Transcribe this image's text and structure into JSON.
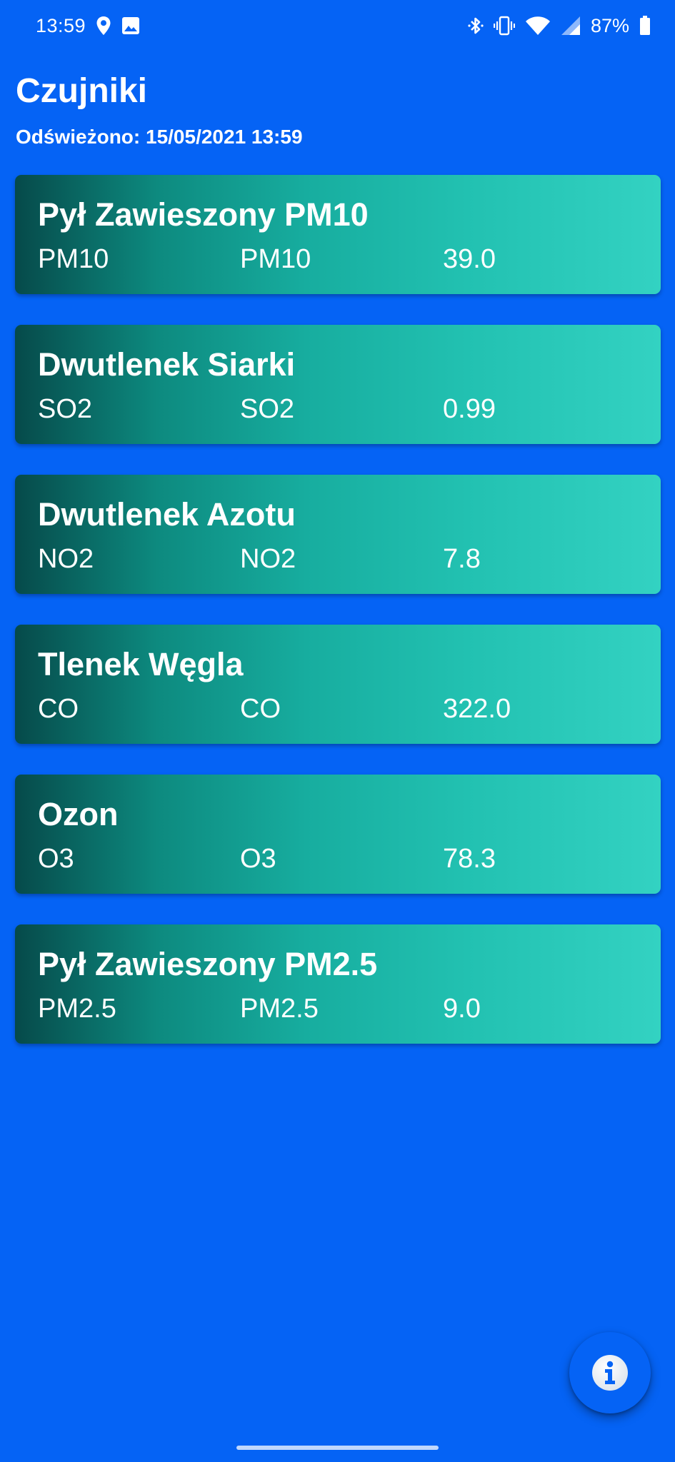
{
  "status_bar": {
    "time": "13:59",
    "battery": "87%",
    "left_icons": [
      "location-icon",
      "image-icon"
    ],
    "right_icons": [
      "bluetooth-icon",
      "vibrate-icon",
      "wifi-icon",
      "signal-icon",
      "battery-icon"
    ]
  },
  "header": {
    "title": "Czujniki",
    "refreshed": "Odświeżono: 15/05/2021 13:59"
  },
  "sensors": [
    {
      "name": "Pył Zawieszony PM10",
      "code": "PM10",
      "formula": "PM10",
      "value": "39.0"
    },
    {
      "name": "Dwutlenek Siarki",
      "code": "SO2",
      "formula": "SO2",
      "value": "0.99"
    },
    {
      "name": "Dwutlenek Azotu",
      "code": "NO2",
      "formula": "NO2",
      "value": "7.8"
    },
    {
      "name": "Tlenek Węgla",
      "code": "CO",
      "formula": "CO",
      "value": "322.0"
    },
    {
      "name": "Ozon",
      "code": "O3",
      "formula": "O3",
      "value": "78.3"
    },
    {
      "name": "Pył Zawieszony PM2.5",
      "code": "PM2.5",
      "formula": "PM2.5",
      "value": "9.0"
    }
  ],
  "fab": {
    "icon": "info-icon"
  },
  "colors": {
    "background": "#0563f5",
    "card_gradient_start": "#064a4a",
    "card_gradient_end": "#33d2c2"
  }
}
